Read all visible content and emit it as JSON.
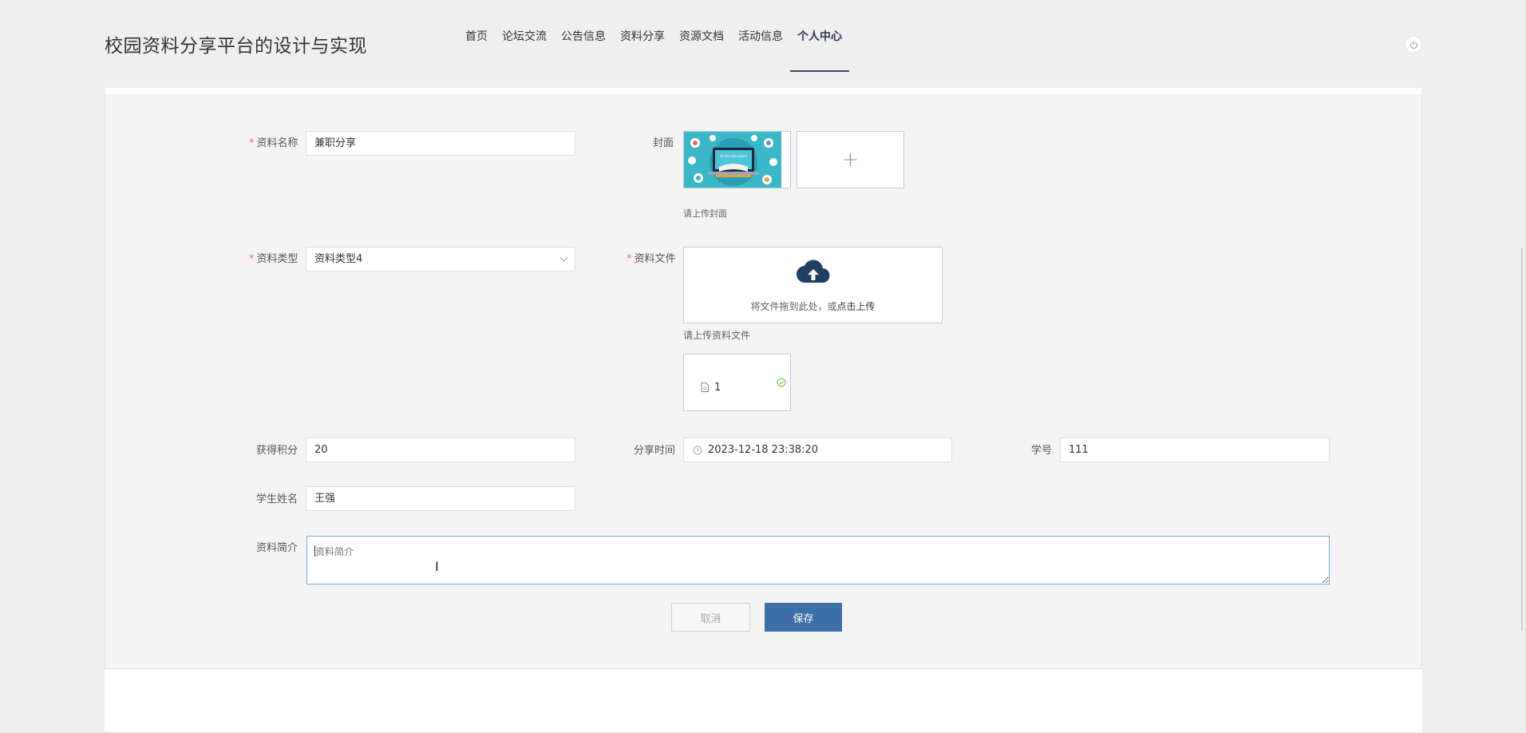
{
  "header": {
    "title": "校园资料分享平台的设计与实现",
    "nav": [
      "首页",
      "论坛交流",
      "公告信息",
      "资料分享",
      "资源文档",
      "活动信息",
      "个人中心"
    ],
    "active_index": 6
  },
  "form": {
    "name": {
      "label": "资料名称",
      "value": "兼职分享"
    },
    "cover": {
      "label": "封面",
      "hint": "请上传封面",
      "add_symbol": "+",
      "image_caption": "Online Education"
    },
    "type": {
      "label": "资料类型",
      "value": "资料类型4"
    },
    "file": {
      "label": "资料文件",
      "drag_text": "将文件拖到此处，或",
      "drag_link": "点击上传",
      "hint": "请上传资料文件",
      "uploaded_name": "1"
    },
    "points": {
      "label": "获得积分",
      "value": "20"
    },
    "share_time": {
      "label": "分享时间",
      "value": "2023-12-18 23:38:20"
    },
    "student_no": {
      "label": "学号",
      "value": "111"
    },
    "student_name": {
      "label": "学生姓名",
      "value": "王强"
    },
    "intro": {
      "label": "资料简介",
      "placeholder": "资料简介"
    }
  },
  "buttons": {
    "cancel": "取消",
    "save": "保存"
  },
  "colors": {
    "primary": "#3d6fa6",
    "required": "#f56c6c",
    "success": "#67c23a",
    "upload_icon": "#1f3f63"
  }
}
